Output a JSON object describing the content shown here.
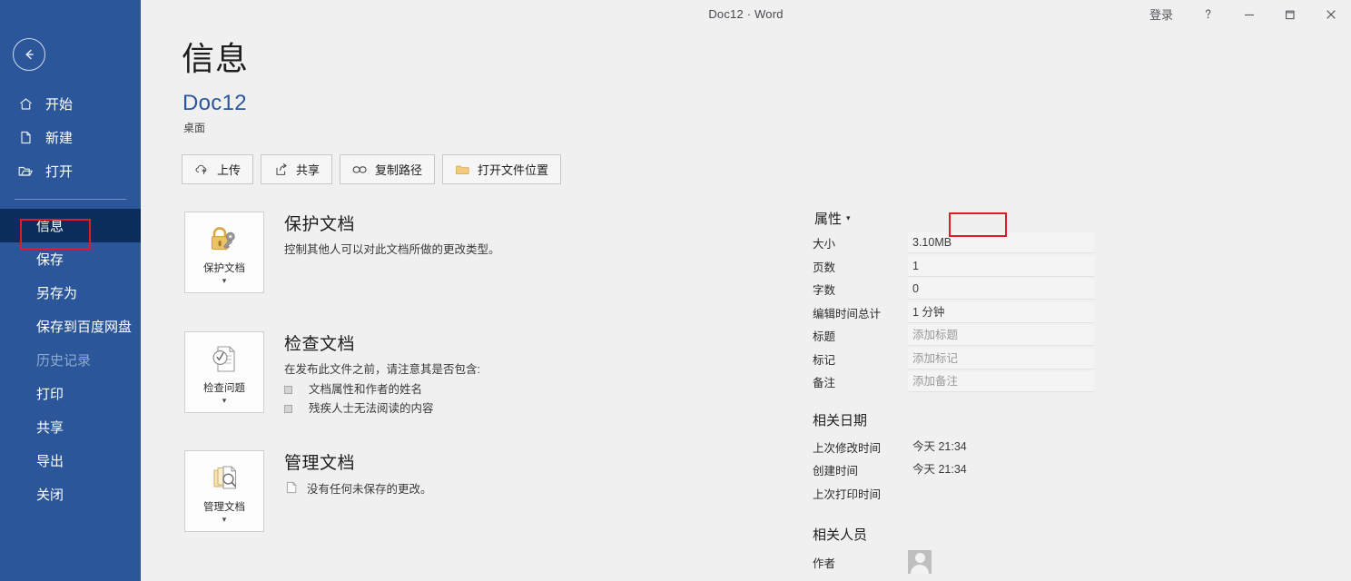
{
  "titlebar": {
    "title": "Doc12  ·  Word",
    "signin_label": "登录",
    "help_icon": "question-mark-icon",
    "minimize_icon": "minimize-icon",
    "restore_icon": "restore-icon",
    "close_icon": "close-icon"
  },
  "sidebar": {
    "back_icon": "back-arrow-icon",
    "background_color": "#2b579a",
    "selected_color": "#0c2c5c",
    "top_items": [
      {
        "label": "开始",
        "icon": "home-icon"
      },
      {
        "label": "新建",
        "icon": "new-document-icon"
      },
      {
        "label": "打开",
        "icon": "open-folder-icon"
      }
    ],
    "items": [
      {
        "label": "信息",
        "state": "selected"
      },
      {
        "label": "保存",
        "state": "normal"
      },
      {
        "label": "另存为",
        "state": "normal"
      },
      {
        "label": "保存到百度网盘",
        "state": "normal"
      },
      {
        "label": "历史记录",
        "state": "disabled"
      },
      {
        "label": "打印",
        "state": "normal"
      },
      {
        "label": "共享",
        "state": "normal"
      },
      {
        "label": "导出",
        "state": "normal"
      },
      {
        "label": "关闭",
        "state": "normal"
      }
    ]
  },
  "main": {
    "page_title": "信息",
    "doc_name": "Doc12",
    "doc_path": "桌面",
    "actions": [
      {
        "label": "上传",
        "icon": "cloud-upload-icon"
      },
      {
        "label": "共享",
        "icon": "share-icon"
      },
      {
        "label": "复制路径",
        "icon": "link-icon"
      },
      {
        "label": "打开文件位置",
        "icon": "folder-icon"
      }
    ],
    "features": {
      "protect": {
        "tile_label": "保护文档",
        "tile_icon": "lock-key-icon",
        "caret": "▾",
        "title": "保护文档",
        "desc": "控制其他人可以对此文档所做的更改类型。"
      },
      "inspect": {
        "tile_label": "检查问题",
        "tile_icon": "inspect-document-icon",
        "caret": "▾",
        "title": "检查文档",
        "desc": "在发布此文件之前，请注意其是否包含:",
        "bullets": [
          "文档属性和作者的姓名",
          "残疾人士无法阅读的内容"
        ]
      },
      "manage": {
        "tile_label": "管理文档",
        "tile_icon": "manage-document-icon",
        "caret": "▾",
        "title": "管理文档",
        "desc": "没有任何未保存的更改。",
        "desc_icon": "document-icon"
      }
    }
  },
  "properties": {
    "heading": "属性",
    "caret": "▾",
    "rows": [
      {
        "key": "大小",
        "value": "3.10MB",
        "placeholder": false
      },
      {
        "key": "页数",
        "value": "1",
        "placeholder": false
      },
      {
        "key": "字数",
        "value": "0",
        "placeholder": false
      },
      {
        "key": "编辑时间总计",
        "value": "1 分钟",
        "placeholder": false
      },
      {
        "key": "标题",
        "value": "添加标题",
        "placeholder": true
      },
      {
        "key": "标记",
        "value": "添加标记",
        "placeholder": true
      },
      {
        "key": "备注",
        "value": "添加备注",
        "placeholder": true
      }
    ],
    "dates": {
      "title": "相关日期",
      "rows": [
        {
          "key": "上次修改时间",
          "value": "今天 21:34"
        },
        {
          "key": "创建时间",
          "value": "今天 21:34"
        },
        {
          "key": "上次打印时间",
          "value": ""
        }
      ]
    },
    "people": {
      "title": "相关人员",
      "author_key": "作者",
      "author_name": "",
      "avatar_icon": "user-avatar-icon"
    }
  },
  "annotations": {
    "color": "#e01b24",
    "boxes": [
      {
        "name": "info-highlight"
      },
      {
        "name": "properties-highlight"
      }
    ]
  }
}
